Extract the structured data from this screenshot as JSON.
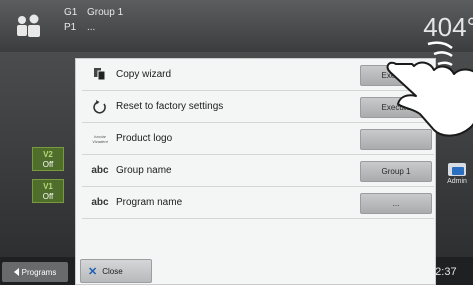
{
  "header": {
    "group_code": "G1",
    "group_name": "Group 1",
    "program_code": "P1",
    "program_name": "...",
    "temperature": "404°"
  },
  "left_badges": [
    {
      "label": "V2",
      "state": "Off"
    },
    {
      "label": "V1",
      "state": "Off"
    }
  ],
  "right_side": {
    "admin_label": "Admin"
  },
  "bottom": {
    "programs_label": "Programs",
    "time": ":42:37"
  },
  "dialog": {
    "rows": [
      {
        "icon": "copy-icon",
        "label": "Copy wizard",
        "button": "Execute"
      },
      {
        "icon": "reset-icon",
        "label": "Reset to factory settings",
        "button": "Execute"
      },
      {
        "icon": "logo-icon",
        "label": "Product logo",
        "button": ""
      },
      {
        "icon": "abc-icon",
        "label": "Group name",
        "button": "Group 1"
      },
      {
        "icon": "abc-icon",
        "label": "Program name",
        "button": "..."
      }
    ],
    "close_label": "Close",
    "abc_text": "abc",
    "logo_text": "Ivoclar Vivadent"
  },
  "colors": {
    "accent": "#1d5fb5",
    "badge_green": "#4f6e2b"
  }
}
